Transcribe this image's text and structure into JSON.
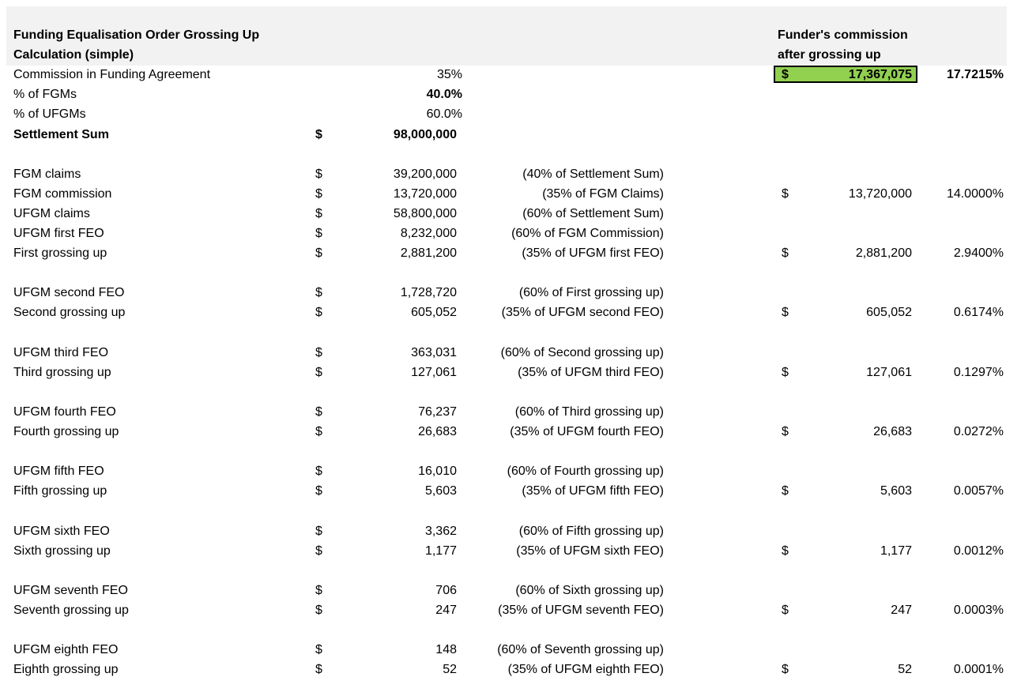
{
  "header": {
    "title_line1": "Funding Equalisation Order Grossing Up",
    "title_line2": "Calculation (simple)",
    "funder_line1": "Funder's commission",
    "funder_line2": "after grossing up"
  },
  "summary": {
    "commission_label": "Commission in Funding Agreement",
    "commission_value": "35%",
    "fgm_pct_label": "% of FGMs",
    "fgm_pct_value": "40.0%",
    "ufgm_pct_label": "% of UFGMs",
    "ufgm_pct_value": "60.0%",
    "settlement_label": "Settlement Sum",
    "settlement_currency": "$",
    "settlement_value": "98,000,000",
    "total_currency": "$",
    "total_commission": "17,367,075",
    "total_pct": "17.7215%"
  },
  "rows": [
    {
      "label": "FGM claims",
      "cur": "$",
      "amount": "39,200,000",
      "note": "(40% of Settlement Sum)",
      "fcur": "",
      "famount": "",
      "fpct": ""
    },
    {
      "label": "FGM commission",
      "cur": "$",
      "amount": "13,720,000",
      "note": "(35% of FGM Claims)",
      "fcur": "$",
      "famount": "13,720,000",
      "fpct": "14.0000%"
    },
    {
      "label": "UFGM claims",
      "cur": "$",
      "amount": "58,800,000",
      "note": "(60% of Settlement Sum)",
      "fcur": "",
      "famount": "",
      "fpct": ""
    },
    {
      "label": "UFGM first FEO",
      "cur": "$",
      "amount": "8,232,000",
      "note": "(60% of FGM Commission)",
      "fcur": "",
      "famount": "",
      "fpct": ""
    },
    {
      "label": "First grossing up",
      "cur": "$",
      "amount": "2,881,200",
      "note": "(35% of UFGM first FEO)",
      "fcur": "$",
      "famount": "2,881,200",
      "fpct": "2.9400%"
    },
    {
      "label": "UFGM second FEO",
      "cur": "$",
      "amount": "1,728,720",
      "note": "(60% of First grossing up)",
      "fcur": "",
      "famount": "",
      "fpct": ""
    },
    {
      "label": "Second grossing up",
      "cur": "$",
      "amount": "605,052",
      "note": "(35% of UFGM second FEO)",
      "fcur": "$",
      "famount": "605,052",
      "fpct": "0.6174%"
    },
    {
      "label": "UFGM third FEO",
      "cur": "$",
      "amount": "363,031",
      "note": "(60% of Second grossing up)",
      "fcur": "",
      "famount": "",
      "fpct": ""
    },
    {
      "label": "Third grossing up",
      "cur": "$",
      "amount": "127,061",
      "note": "(35% of UFGM third FEO)",
      "fcur": "$",
      "famount": "127,061",
      "fpct": "0.1297%"
    },
    {
      "label": "UFGM fourth FEO",
      "cur": "$",
      "amount": "76,237",
      "note": "(60% of Third grossing up)",
      "fcur": "",
      "famount": "",
      "fpct": ""
    },
    {
      "label": "Fourth grossing up",
      "cur": "$",
      "amount": "26,683",
      "note": "(35% of UFGM fourth FEO)",
      "fcur": "$",
      "famount": "26,683",
      "fpct": "0.0272%"
    },
    {
      "label": "UFGM fifth FEO",
      "cur": "$",
      "amount": "16,010",
      "note": "(60% of Fourth grossing up)",
      "fcur": "",
      "famount": "",
      "fpct": ""
    },
    {
      "label": "Fifth grossing up",
      "cur": "$",
      "amount": "5,603",
      "note": "(35% of UFGM fifth FEO)",
      "fcur": "$",
      "famount": "5,603",
      "fpct": "0.0057%"
    },
    {
      "label": "UFGM sixth FEO",
      "cur": "$",
      "amount": "3,362",
      "note": "(60% of Fifth grossing up)",
      "fcur": "",
      "famount": "",
      "fpct": ""
    },
    {
      "label": "Sixth grossing up",
      "cur": "$",
      "amount": "1,177",
      "note": "(35% of UFGM sixth FEO)",
      "fcur": "$",
      "famount": "1,177",
      "fpct": "0.0012%"
    },
    {
      "label": "UFGM seventh FEO",
      "cur": "$",
      "amount": "706",
      "note": "(60% of Sixth grossing up)",
      "fcur": "",
      "famount": "",
      "fpct": ""
    },
    {
      "label": "Seventh grossing up",
      "cur": "$",
      "amount": "247",
      "note": "(35% of UFGM seventh FEO)",
      "fcur": "$",
      "famount": "247",
      "fpct": "0.0003%"
    },
    {
      "label": "UFGM eighth FEO",
      "cur": "$",
      "amount": "148",
      "note": "(60% of Seventh grossing up)",
      "fcur": "",
      "famount": "",
      "fpct": ""
    },
    {
      "label": "Eighth grossing up",
      "cur": "$",
      "amount": "52",
      "note": "(35% of UFGM eighth FEO)",
      "fcur": "$",
      "famount": "52",
      "fpct": "0.0001%"
    }
  ],
  "colors": {
    "header_band": "#f2f2f2",
    "highlight_fill": "#92d050",
    "highlight_border": "#000000"
  }
}
